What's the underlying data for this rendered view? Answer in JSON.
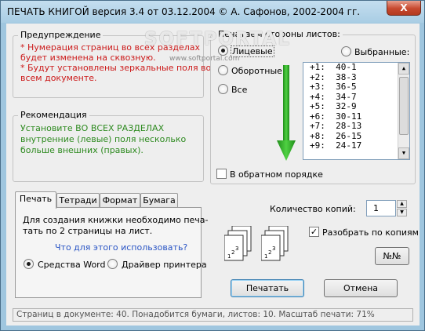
{
  "window": {
    "title": "ПЕЧАТЬ КНИГОЙ   версия 3.4 от 03.12.2004   © А. Сафонов, 2002-2004 гг.",
    "close_glyph": "X"
  },
  "warning": {
    "legend": "Предупреждение",
    "line1": "* Нумерация страниц во всех разделах",
    "line2": "будет изменена на сквозную.",
    "line3": "* Будут установлены зеркальные поля во",
    "line4": "всем документе.",
    "color": "#cc1a1a"
  },
  "recommendation": {
    "legend": "Рекомендация",
    "line1": "Установите ВО ВСЕХ РАЗДЕЛАХ",
    "line2": "внутренние (левые) поля несколько",
    "line3": "больше внешних (правых).",
    "color": "#2d8a1f"
  },
  "sides": {
    "legend": "Печатаем стороны листов:",
    "option_front": "Лицевые",
    "option_back": "Оборотные",
    "option_all": "Все",
    "option_selected": "Выбранные:",
    "selected": "Лицевые",
    "reverse_label": "В обратном порядке",
    "reverse_checked": false,
    "pages": [
      "+1:  40-1",
      "+2:  38-3",
      "+3:  36-5",
      "+4:  34-7",
      "+5:  32-9",
      "+6:  30-11",
      "+7:  28-13",
      "+8:  26-15",
      "+9:  24-17"
    ],
    "arrow_color": "#33b82a"
  },
  "tabs": {
    "items": [
      "Печать",
      "Тетради",
      "Формат",
      "Бумага"
    ],
    "active": "Печать",
    "text_line1": "Для создания книжки необходимо печа-",
    "text_line2": "тать по 2 страницы на лист.",
    "link": "Что для этого использовать?",
    "option_word": "Средства Word",
    "option_driver": "Драйвер принтера",
    "selected_option": "Средства Word"
  },
  "copies": {
    "label": "Количество копий:",
    "value": "1",
    "collate_label": "Разобрать по копиям",
    "collate_checked": true,
    "collate_glyph": "✓",
    "stack_a": [
      "1",
      "2",
      "3"
    ],
    "stack_b": [
      "1",
      "2",
      "3"
    ]
  },
  "buttons": {
    "numbers": "№№",
    "print": "Печатать",
    "cancel": "Отмена"
  },
  "status": {
    "text": "Страниц в документе: 40. Понадобится бумаги, листов: 10. Масштаб печати: 71%"
  },
  "watermark": {
    "text": "SOFTPORTAL",
    "url": "www.softportal.com"
  }
}
